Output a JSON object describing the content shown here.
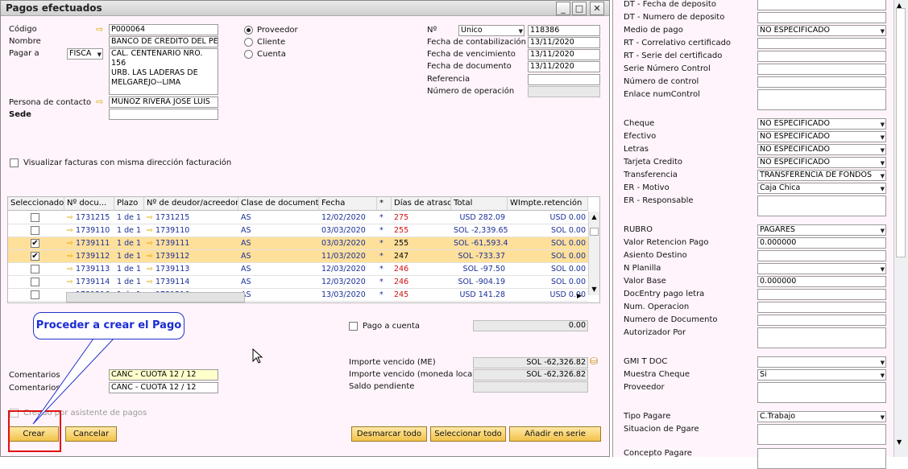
{
  "window": {
    "title": "Pagos efectuados"
  },
  "header": {
    "codigo_label": "Código",
    "codigo_value": "P000064",
    "nombre_label": "Nombre",
    "nombre_value": "BANCO DE CREDITO DEL PE",
    "pagar_a_label": "Pagar a",
    "pagar_a_select": "FISCA",
    "direccion_lines": [
      "CAL. CENTENARIO NRO. 156",
      "URB. LAS LADERAS DE",
      "MELGAREJO--LIMA"
    ],
    "contacto_label": "Persona de contacto",
    "contacto_value": "MUÑOZ RIVERA JOSE LUIS",
    "sede_label": "Sede",
    "sede_value": "",
    "radio": [
      "Proveedor",
      "Cliente",
      "Cuenta"
    ],
    "no_label": "Nº",
    "no_series": "Unico",
    "no_value": "118386",
    "fecha_contab_label": "Fecha de contabilización",
    "fecha_contab_value": "13/11/2020",
    "fecha_venc_label": "Fecha de vencimiento",
    "fecha_venc_value": "13/11/2020",
    "fecha_doc_label": "Fecha de documento",
    "fecha_doc_value": "13/11/2020",
    "referencia_label": "Referencia",
    "referencia_value": "",
    "num_op_label": "Número de operación",
    "num_op_value": "",
    "visualizar_label": "Visualizar facturas con misma dirección facturación"
  },
  "grid": {
    "columns": [
      "Seleccionado",
      "Nº docu...",
      "Plazo",
      "Nº de deudor/acreedor",
      "Clase de documento",
      "Fecha",
      "*",
      "Días de atraso",
      "Total",
      "WImpte.retención"
    ],
    "rows": [
      {
        "sel": false,
        "doc": "1731215",
        "plazo": "1 de 1",
        "deudor": "1731215",
        "clase": "AS",
        "fecha": "12/02/2020",
        "star": "*",
        "dias": "275",
        "dias_red": true,
        "total": "USD 282.09",
        "ret": "USD 0.00"
      },
      {
        "sel": false,
        "doc": "1739110",
        "plazo": "1 de 1",
        "deudor": "1739110",
        "clase": "AS",
        "fecha": "03/03/2020",
        "star": "*",
        "dias": "255",
        "dias_red": true,
        "total": "SOL -2,339.65",
        "ret": "SOL 0.00"
      },
      {
        "sel": true,
        "doc": "1739111",
        "plazo": "1 de 1",
        "deudor": "1739111",
        "clase": "AS",
        "fecha": "03/03/2020",
        "star": "*",
        "dias": "255",
        "dias_red": false,
        "total": "SOL -61,593.45",
        "ret": "SOL 0.00"
      },
      {
        "sel": true,
        "doc": "1739112",
        "plazo": "1 de 1",
        "deudor": "1739112",
        "clase": "AS",
        "fecha": "11/03/2020",
        "star": "*",
        "dias": "247",
        "dias_red": false,
        "total": "SOL -733.37",
        "ret": "SOL 0.00"
      },
      {
        "sel": false,
        "doc": "1739113",
        "plazo": "1 de 1",
        "deudor": "1739113",
        "clase": "AS",
        "fecha": "12/03/2020",
        "star": "*",
        "dias": "246",
        "dias_red": true,
        "total": "SOL -97.50",
        "ret": "SOL 0.00"
      },
      {
        "sel": false,
        "doc": "1739114",
        "plazo": "1 de 1",
        "deudor": "1739114",
        "clase": "AS",
        "fecha": "12/03/2020",
        "star": "*",
        "dias": "246",
        "dias_red": true,
        "total": "SOL -904.19",
        "ret": "SOL 0.00"
      },
      {
        "sel": false,
        "doc": "1731216",
        "plazo": "1 de 1",
        "deudor": "1731216",
        "clase": "AS",
        "fecha": "13/03/2020",
        "star": "*",
        "dias": "245",
        "dias_red": true,
        "total": "USD 141.28",
        "ret": "USD 0.00"
      }
    ]
  },
  "footer": {
    "pago_cuenta_label": "Pago a cuenta",
    "pago_cuenta_value": "0.00",
    "importe_me_label": "Importe vencido (ME)",
    "importe_me_value": "SOL -62,326.82",
    "importe_ml_label": "Importe vencido (moneda local)",
    "importe_ml_value": "SOL -62,326.82",
    "saldo_label": "Saldo pendiente",
    "saldo_value": "",
    "comentarios_label": "Comentarios",
    "comentarios1": "CANC - CUOTA 12 / 12",
    "comentarios2": "CANC - CUOTA 12 / 12",
    "asistente_label": "Creado por asistente de pagos",
    "crear": "Crear",
    "cancelar": "Cancelar",
    "desmarcar": "Desmarcar todo",
    "seleccionar": "Seleccionar todo",
    "anadir": "Añadir en serie"
  },
  "callout": "Proceder a crear el Pago",
  "right_panel": {
    "fields": [
      {
        "label": "DT - Fecha de deposito",
        "value": "",
        "type": "text"
      },
      {
        "label": "DT - Numero de deposito",
        "value": "",
        "type": "text"
      },
      {
        "label": "Medio de pago",
        "value": "NO ESPECIFICADO",
        "type": "select"
      },
      {
        "label": "RT - Correlativo certificado",
        "value": "",
        "type": "text"
      },
      {
        "label": "RT - Serie del certificado",
        "value": "",
        "type": "text"
      },
      {
        "label": "Serie Número Control",
        "value": "",
        "type": "text"
      },
      {
        "label": "Número de control",
        "value": "",
        "type": "text"
      },
      {
        "label": "Enlace numControl",
        "value": "",
        "type": "tall"
      },
      {
        "label": "Cheque",
        "value": "NO ESPECIFICADO",
        "type": "select"
      },
      {
        "label": "Efectivo",
        "value": "NO ESPECIFICADO",
        "type": "select"
      },
      {
        "label": "Letras",
        "value": "NO ESPECIFICADO",
        "type": "select"
      },
      {
        "label": "Tarjeta Credito",
        "value": "NO ESPECIFICADO",
        "type": "select"
      },
      {
        "label": "Transferencia",
        "value": "TRANSFERENCIA DE FONDOS",
        "type": "select"
      },
      {
        "label": "ER - Motivo",
        "value": "Caja Chica",
        "type": "select"
      },
      {
        "label": "ER - Responsable",
        "value": "",
        "type": "tall"
      },
      {
        "label": "RUBRO",
        "value": "PAGARES",
        "type": "select"
      },
      {
        "label": "Valor Retencion Pago",
        "value": "0.000000",
        "type": "text"
      },
      {
        "label": "Asiento Destino",
        "value": "",
        "type": "text"
      },
      {
        "label": "N Planilla",
        "value": "",
        "type": "select"
      },
      {
        "label": "Valor Base",
        "value": "0.000000",
        "type": "text"
      },
      {
        "label": "DocEntry pago letra",
        "value": "",
        "type": "text"
      },
      {
        "label": "Num. Operacion",
        "value": "",
        "type": "text"
      },
      {
        "label": "Numero de Documento",
        "value": "",
        "type": "text"
      },
      {
        "label": "Autorizador Por",
        "value": "",
        "type": "tall"
      },
      {
        "label": "GMI T DOC",
        "value": "",
        "type": "select"
      },
      {
        "label": "Muestra Cheque",
        "value": "Si",
        "type": "select"
      },
      {
        "label": "Proveedor",
        "value": "",
        "type": "tall"
      },
      {
        "label": "Tipo Pagare",
        "value": "C.Trabajo",
        "type": "select"
      },
      {
        "label": "Situacion de Pgare",
        "value": "",
        "type": "tall"
      },
      {
        "label": "Concepto Pagare",
        "value": "",
        "type": "tall"
      }
    ]
  }
}
